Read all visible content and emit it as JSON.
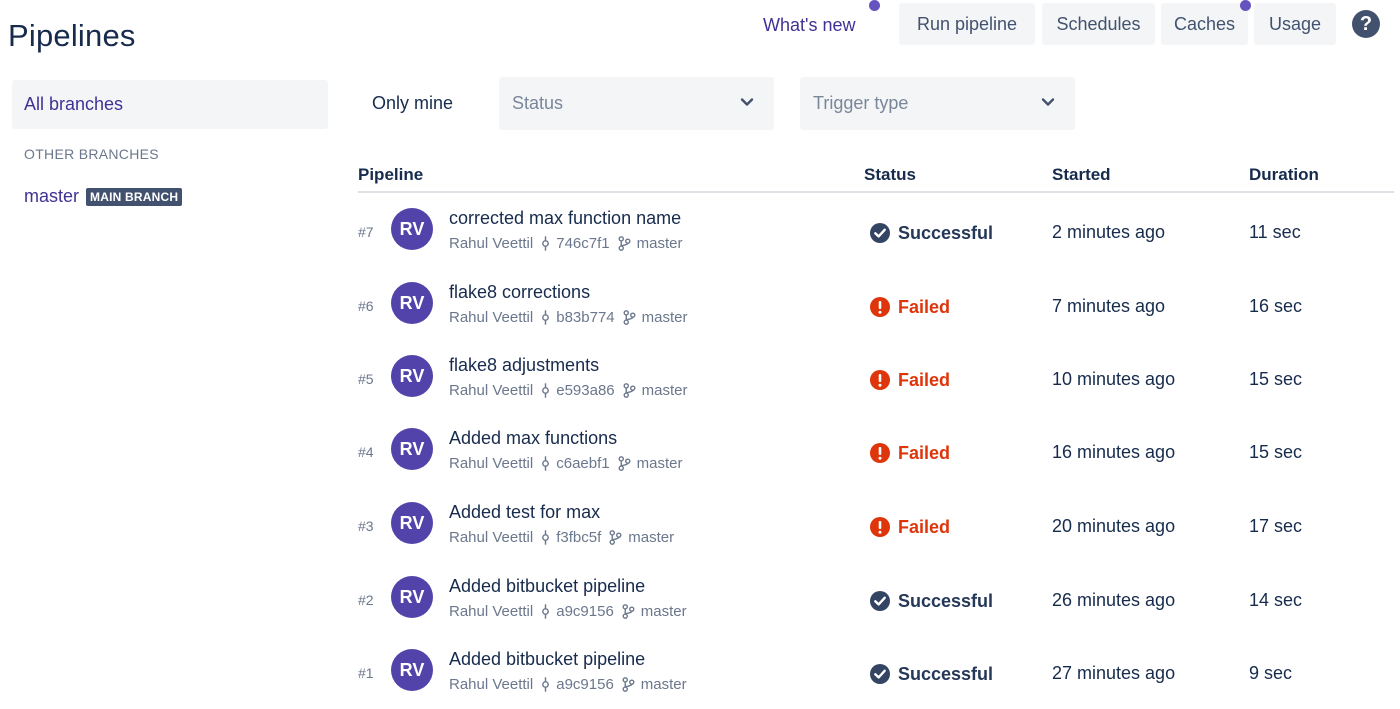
{
  "page": {
    "title": "Pipelines"
  },
  "header": {
    "whats_new": "What's new",
    "run_pipeline": "Run pipeline",
    "schedules": "Schedules",
    "caches": "Caches",
    "usage": "Usage",
    "help_icon": "?"
  },
  "sidebar": {
    "all_branches": "All branches",
    "other_heading": "OTHER BRANCHES",
    "branch_name": "master",
    "main_badge": "MAIN BRANCH"
  },
  "filters": {
    "only_mine": "Only mine",
    "status_placeholder": "Status",
    "trigger_placeholder": "Trigger type"
  },
  "table": {
    "headers": {
      "pipeline": "Pipeline",
      "status": "Status",
      "started": "Started",
      "duration": "Duration"
    },
    "rows": [
      {
        "num": "#7",
        "initials": "RV",
        "title": "corrected max function name",
        "author": "Rahul Veettil",
        "commit": "746c7f1",
        "branch": "master",
        "status": "Successful",
        "state": "success",
        "started": "2 minutes ago",
        "duration": "11 sec"
      },
      {
        "num": "#6",
        "initials": "RV",
        "title": "flake8 corrections",
        "author": "Rahul Veettil",
        "commit": "b83b774",
        "branch": "master",
        "status": "Failed",
        "state": "failed",
        "started": "7 minutes ago",
        "duration": "16 sec"
      },
      {
        "num": "#5",
        "initials": "RV",
        "title": "flake8 adjustments",
        "author": "Rahul Veettil",
        "commit": "e593a86",
        "branch": "master",
        "status": "Failed",
        "state": "failed",
        "started": "10 minutes ago",
        "duration": "15 sec"
      },
      {
        "num": "#4",
        "initials": "RV",
        "title": "Added max functions",
        "author": "Rahul Veettil",
        "commit": "c6aebf1",
        "branch": "master",
        "status": "Failed",
        "state": "failed",
        "started": "16 minutes ago",
        "duration": "15 sec"
      },
      {
        "num": "#3",
        "initials": "RV",
        "title": "Added test for max",
        "author": "Rahul Veettil",
        "commit": "f3fbc5f",
        "branch": "master",
        "status": "Failed",
        "state": "failed",
        "started": "20 minutes ago",
        "duration": "17 sec"
      },
      {
        "num": "#2",
        "initials": "RV",
        "title": "Added bitbucket pipeline",
        "author": "Rahul Veettil",
        "commit": "a9c9156",
        "branch": "master",
        "status": "Successful",
        "state": "success",
        "started": "26 minutes ago",
        "duration": "14 sec"
      },
      {
        "num": "#1",
        "initials": "RV",
        "title": "Added bitbucket pipeline",
        "author": "Rahul Veettil",
        "commit": "a9c9156",
        "branch": "master",
        "status": "Successful",
        "state": "success",
        "started": "27 minutes ago",
        "duration": "9 sec"
      }
    ]
  },
  "colors": {
    "success_text": "#253858",
    "success_icon": "#344563",
    "failed": "#de350b",
    "avatar": "#5243aa",
    "link": "#403294",
    "badge": "#42526e"
  },
  "icons": {
    "commit": "commit-icon",
    "branch": "branch-icon",
    "success": "check-circle-icon",
    "failed": "error-icon",
    "chevron": "chevron-down-icon"
  }
}
